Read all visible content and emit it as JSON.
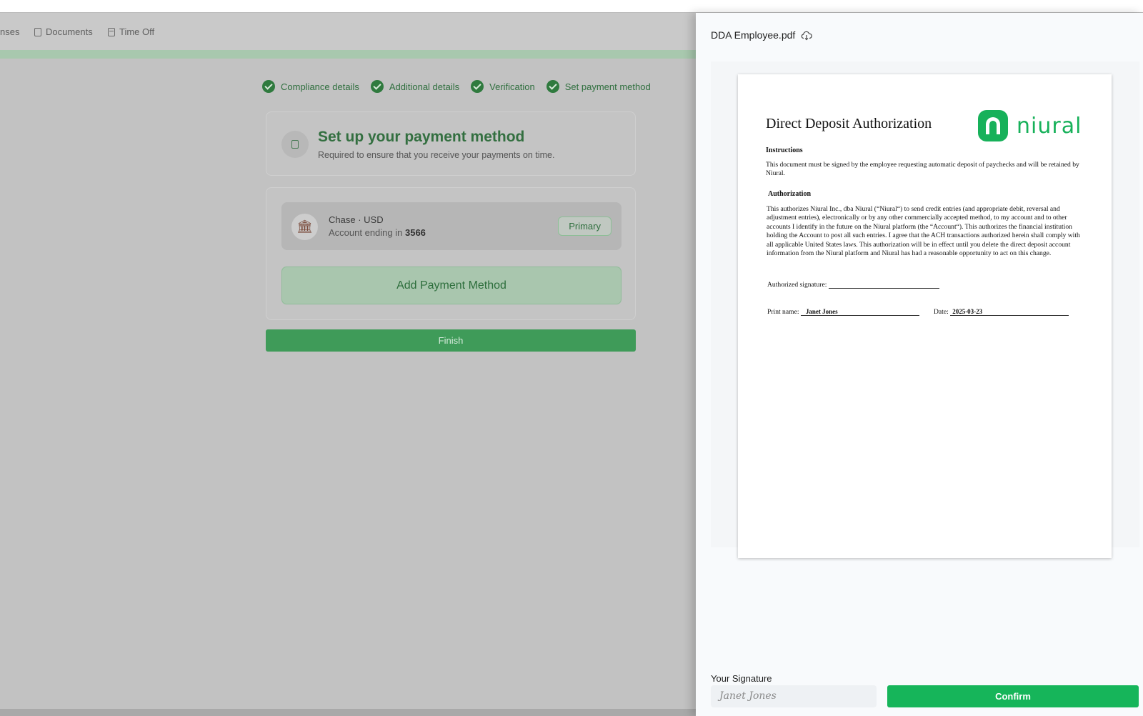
{
  "nav": {
    "items": [
      {
        "label": "nses",
        "icon": "none"
      },
      {
        "label": "Documents",
        "icon": "document-icon"
      },
      {
        "label": "Time Off",
        "icon": "calendar-icon"
      }
    ]
  },
  "progress_fraction": 1.0,
  "steps": [
    {
      "label": "Compliance details"
    },
    {
      "label": "Additional details"
    },
    {
      "label": "Verification"
    },
    {
      "label": "Set payment method"
    }
  ],
  "header_card": {
    "title": "Set up your payment method",
    "subtitle": "Required to ensure that you receive your payments on time."
  },
  "account": {
    "name": "Chase · USD",
    "ending_prefix": "Account ending in",
    "ending_number": "3566",
    "badge": "Primary"
  },
  "add_payment_label": "Add Payment Method",
  "finish_label": "Finish",
  "panel": {
    "file_name": "DDA Employee.pdf",
    "document": {
      "title": "Direct Deposit Authorization",
      "logo_text": "niural",
      "instructions_heading": "Instructions",
      "instructions_text": "This document must be signed by the employee requesting automatic deposit of paychecks and will be retained by Niural.",
      "authorization_heading": "Authorization",
      "authorization_text": "This authorizes Niural Inc., dba Niural (“Niural“) to send credit entries (and appropriate debit, reversal and adjustment entries), electronically or by any other commercially accepted method, to my account and to other accounts I identify in the future on the Niural platform (the “Account“). This authorizes the financial institution holding the Account to post all such entries. I agree that the ACH transactions authorized herein shall comply with all applicable United States laws. This authorization will be in effect until you delete the direct deposit account information from the Niural platform and Niural has had a reasonable opportunity to act on this change.",
      "signature_label": "Authorized signature:",
      "print_name_label": "Print name:",
      "print_name_value": "Janet Jones",
      "date_label": "Date:",
      "date_value": "2025-03-23"
    },
    "signature_label": "Your Signature",
    "signature_value": "Janet Jones",
    "confirm_label": "Confirm"
  },
  "colors": {
    "brand_green": "#17b15a",
    "dim_green": "#3f9b59",
    "step_green": "#2f7a3e"
  }
}
